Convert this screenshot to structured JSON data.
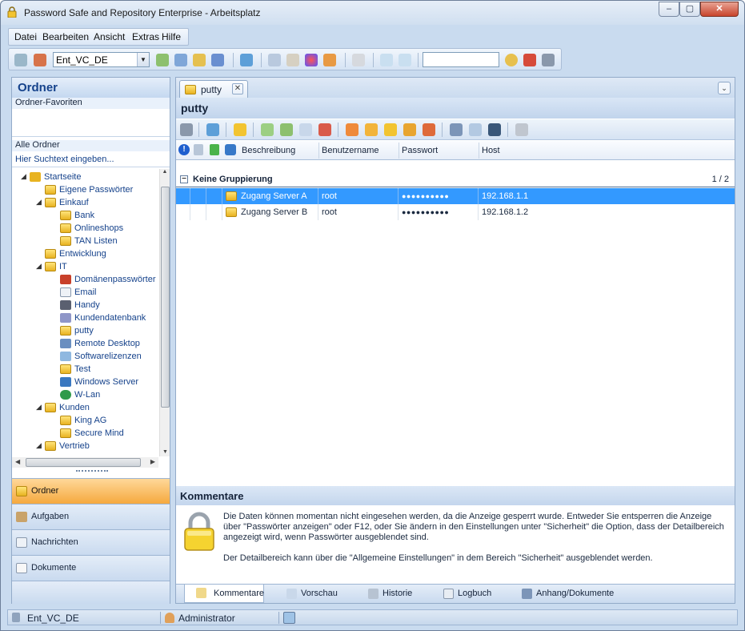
{
  "window": {
    "title": "Password Safe and Repository Enterprise - Arbeitsplatz",
    "min": "‒",
    "max": "▢",
    "close": "✕"
  },
  "menu": [
    "Datei",
    "Bearbeiten",
    "Ansicht",
    "Extras",
    "Hilfe"
  ],
  "toolbar": {
    "database": "Ent_VC_DE",
    "search_value": ""
  },
  "left": {
    "header": "Ordner",
    "favorites_label": "Ordner-Favoriten",
    "all_label": "Alle Ordner",
    "filter_placeholder": "Hier Suchtext eingeben...",
    "tree": [
      {
        "label": "Startseite",
        "level": 0,
        "icon": "home-icon",
        "expander": "−"
      },
      {
        "label": "Eigene Passwörter",
        "level": 1,
        "icon": "folder-icon"
      },
      {
        "label": "Einkauf",
        "level": 1,
        "icon": "folder-icon",
        "expander": "−"
      },
      {
        "label": "Bank",
        "level": 2,
        "icon": "folder-icon"
      },
      {
        "label": "Onlineshops",
        "level": 2,
        "icon": "folder-icon"
      },
      {
        "label": "TAN Listen",
        "level": 2,
        "icon": "folder-icon"
      },
      {
        "label": "Entwicklung",
        "level": 1,
        "icon": "folder-icon"
      },
      {
        "label": "IT",
        "level": 1,
        "icon": "folder-icon",
        "expander": "−"
      },
      {
        "label": "Domänenpasswörter",
        "level": 2,
        "icon": "ribbon-icon"
      },
      {
        "label": "Email",
        "level": 2,
        "icon": "envelope-icon"
      },
      {
        "label": "Handy",
        "level": 2,
        "icon": "phone-icon"
      },
      {
        "label": "Kundendatenbank",
        "level": 2,
        "icon": "database-icon"
      },
      {
        "label": "putty",
        "level": 2,
        "icon": "folder-icon"
      },
      {
        "label": "Remote Desktop",
        "level": 2,
        "icon": "network-icon"
      },
      {
        "label": "Softwarelizenzen",
        "level": 2,
        "icon": "license-icon"
      },
      {
        "label": "Test",
        "level": 2,
        "icon": "folder-icon"
      },
      {
        "label": "Windows Server",
        "level": 2,
        "icon": "server-icon"
      },
      {
        "label": "W-Lan",
        "level": 2,
        "icon": "globe-icon"
      },
      {
        "label": "Kunden",
        "level": 1,
        "icon": "folder-icon",
        "expander": "−"
      },
      {
        "label": "King AG",
        "level": 2,
        "icon": "folder-icon"
      },
      {
        "label": "Secure Mind",
        "level": 2,
        "icon": "folder-icon"
      },
      {
        "label": "Vertrieb",
        "level": 1,
        "icon": "folder-icon",
        "expander": "−"
      }
    ],
    "nav": [
      "Ordner",
      "Aufgaben",
      "Nachrichten",
      "Dokumente"
    ]
  },
  "right": {
    "tab": "putty",
    "title": "putty",
    "columns": {
      "desc": "Beschreibung",
      "user": "Benutzername",
      "pass": "Passwort",
      "host": "Host"
    },
    "group": {
      "label": "Keine Gruppierung",
      "count": "1 / 2"
    },
    "rows": [
      {
        "desc": "Zugang Server A",
        "user": "root",
        "pass": "●●●●●●●●●●",
        "host": "192.168.1.1"
      },
      {
        "desc": "Zugang Server B",
        "user": "root",
        "pass": "●●●●●●●●●●",
        "host": "192.168.1.2"
      }
    ],
    "comments_title": "Kommentare",
    "comments_text1": "Die Daten können momentan nicht eingesehen werden, da die Anzeige gesperrt wurde. Entweder Sie entsperren die Anzeige über \"Passwörter anzeigen\" oder F12, oder Sie ändern in den Einstellungen unter \"Sicherheit\" die Option, dass der Detailbereich angezeigt wird, wenn Passwörter ausgeblendet sind.",
    "comments_text2": "Der Detailbereich kann über die \"Allgemeine Einstellungen\" in dem Bereich \"Sicherheit\" ausgeblendet werden.",
    "bottom_tabs": [
      "Kommentare",
      "Vorschau",
      "Historie",
      "Logbuch",
      "Anhang/Dokumente"
    ]
  },
  "status": {
    "db": "Ent_VC_DE",
    "user": "Administrator"
  }
}
